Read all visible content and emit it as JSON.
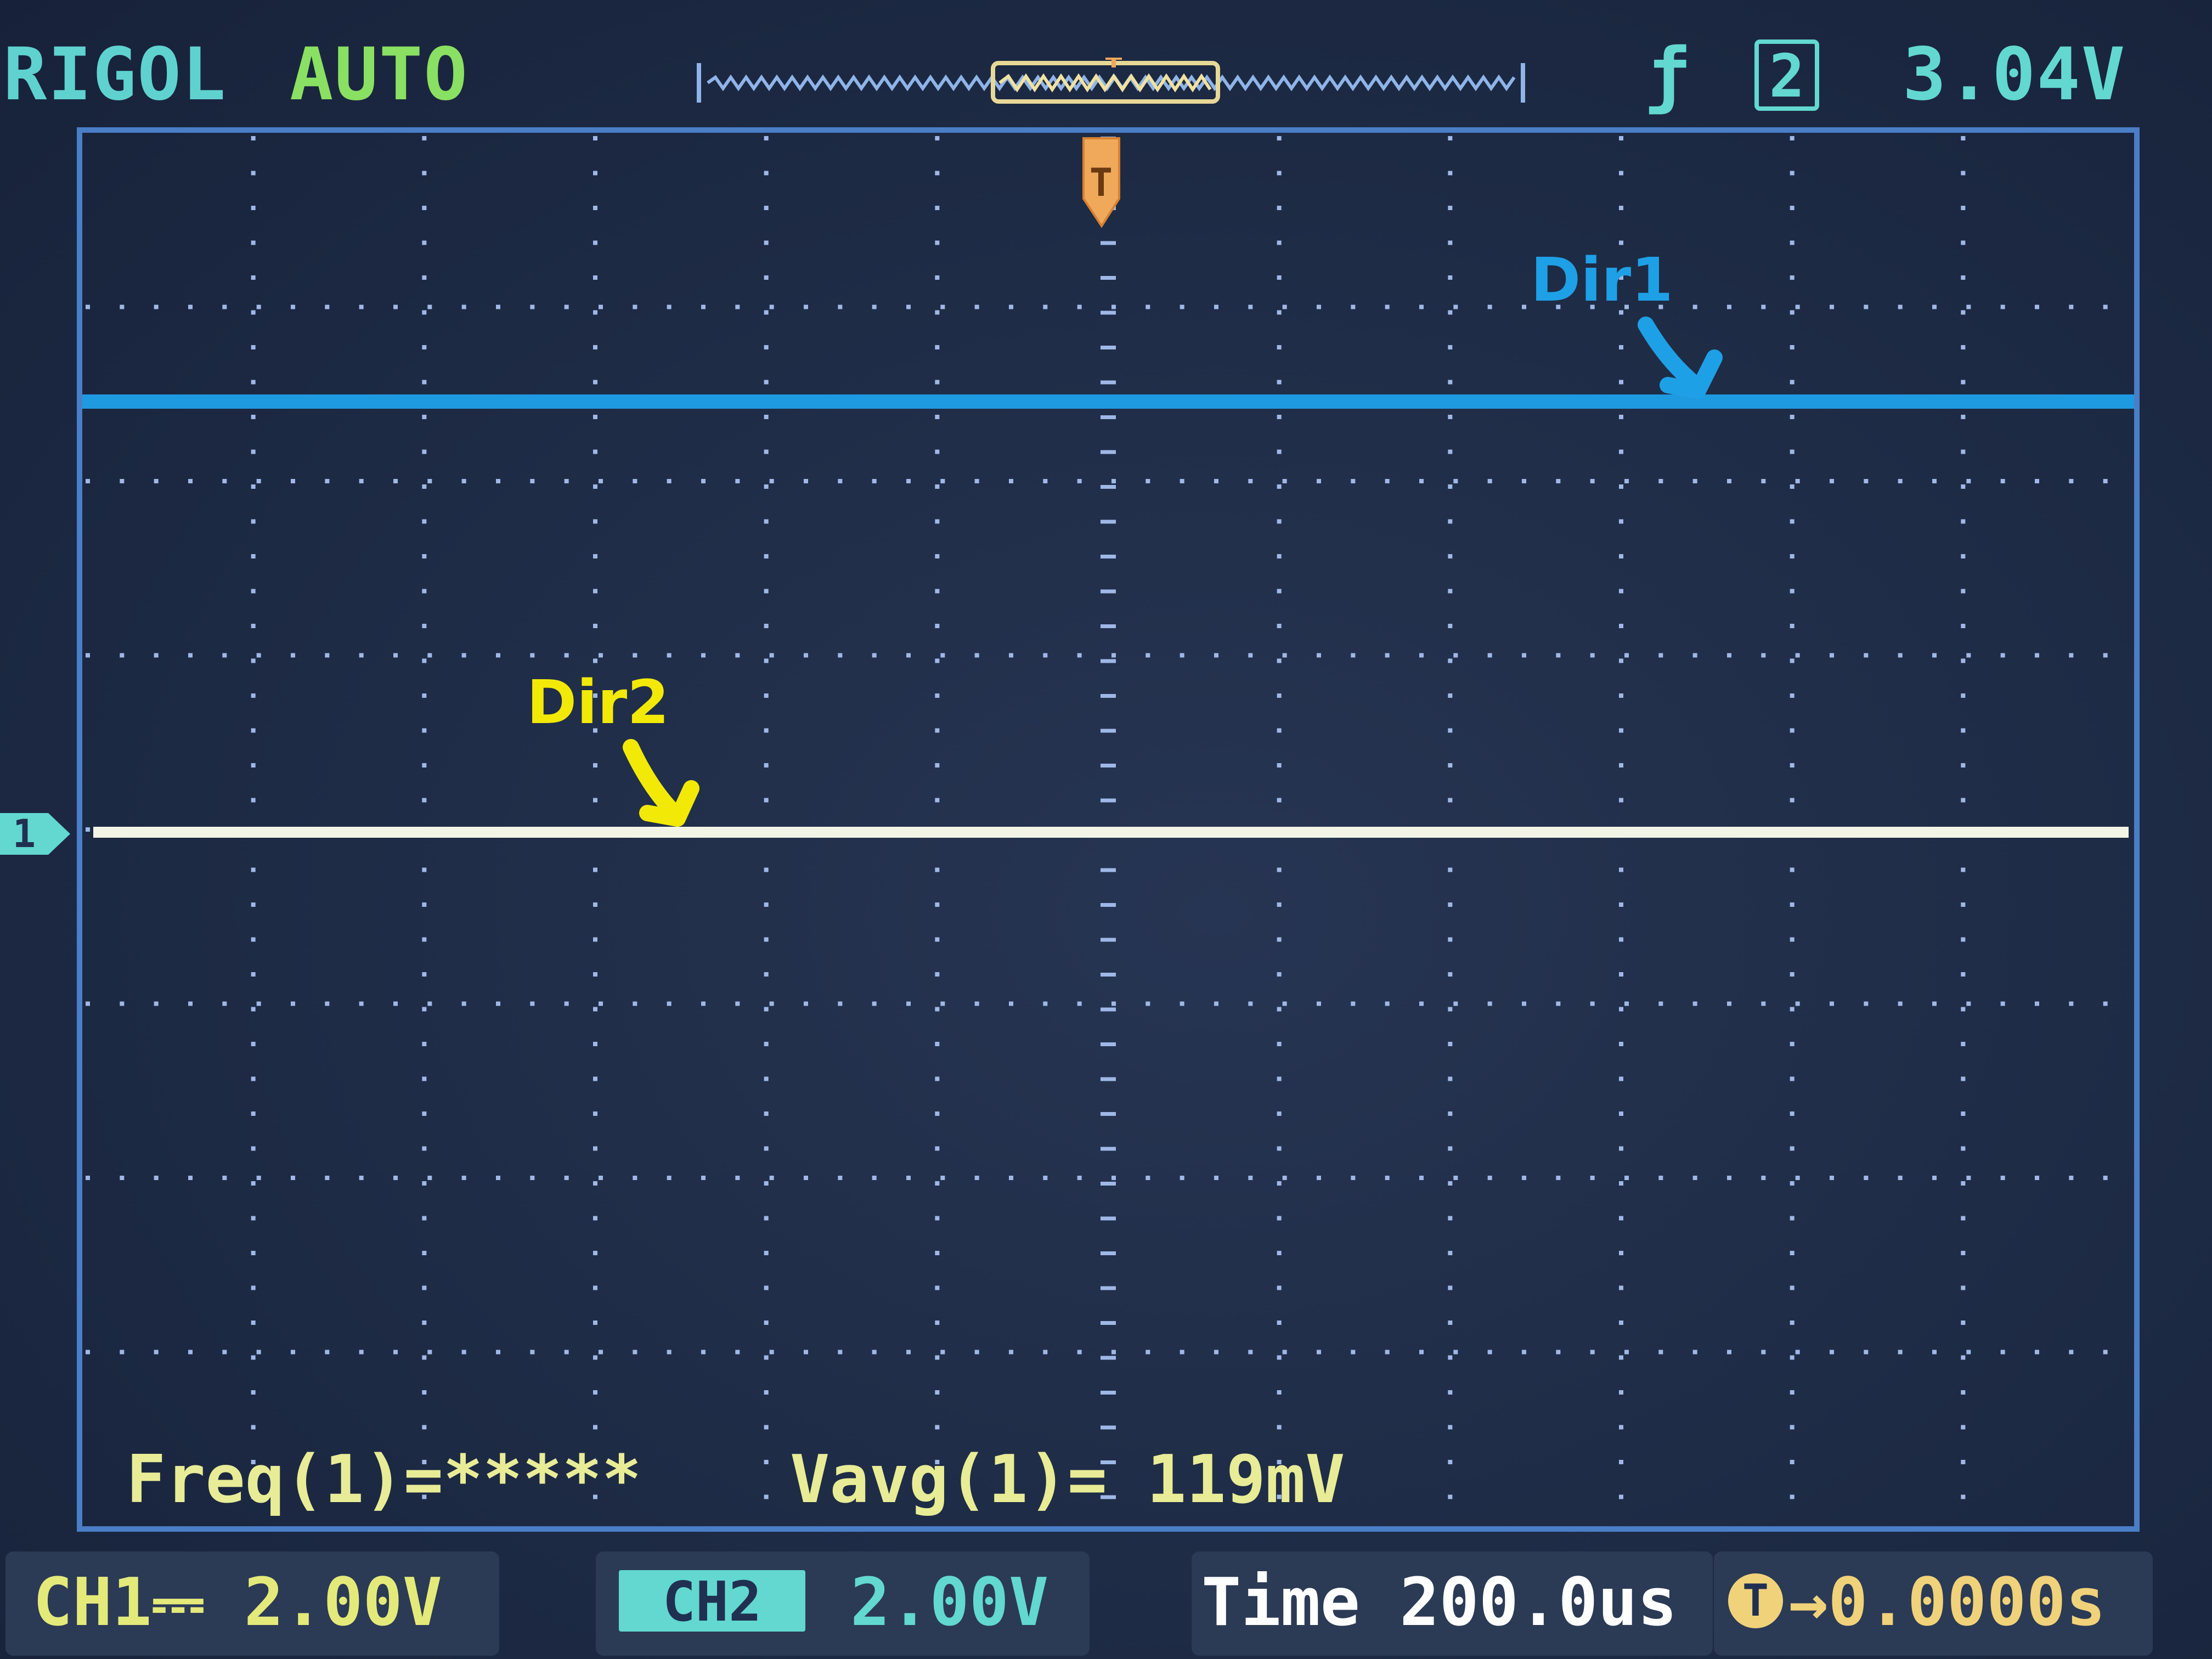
{
  "header": {
    "brand": "RIGOL",
    "mode": "AUTO",
    "trigger_edge_icon": "rising-edge-icon",
    "trigger_source": "2",
    "trigger_level": "3.04V"
  },
  "colors": {
    "ch1_trace": "#f2f4e6",
    "ch2_trace": "#1e9ae0",
    "grid": "#9fb8e6",
    "border": "#4a7ec6",
    "trigger_marker": "#f0a85a",
    "dir1_annotation": "#1ea0e6",
    "dir2_annotation": "#f2ea06"
  },
  "measurements": {
    "freq": "Freq(1)=*****",
    "vavg": "Vavg(1)= 119mV"
  },
  "status_bar": {
    "ch1_label": "CH1",
    "ch1_coupling_icon": "dc-coupling-icon",
    "ch1_scale": "2.00V",
    "ch2_label": "CH2",
    "ch2_scale": "2.00V",
    "time_label": "Time",
    "time_scale": "200.0us",
    "position_icon": "trigger-position-icon",
    "position_value": "→0.0000s"
  },
  "trigger_marker_label": "T",
  "ground_marker_label": "1",
  "annotations": {
    "dir1": "Dir1",
    "dir2": "Dir2"
  }
}
